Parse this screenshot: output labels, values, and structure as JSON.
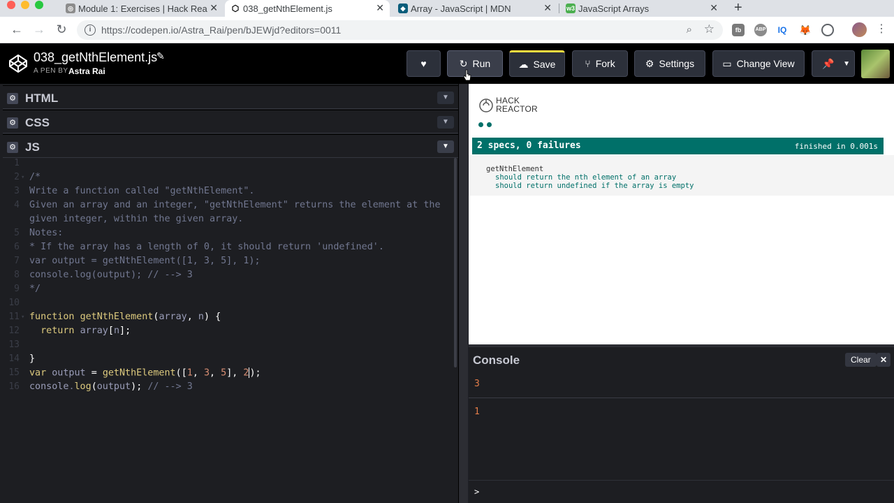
{
  "browser": {
    "tabs": [
      {
        "label": "Module 1: Exercises | Hack Rea",
        "icon": "codepen-icon",
        "active": false
      },
      {
        "label": "038_getNthElement.js",
        "icon": "codepen-icon",
        "active": true
      },
      {
        "label": "Array - JavaScript | MDN",
        "icon": "mdn-icon",
        "active": false
      },
      {
        "label": "JavaScript Arrays",
        "icon": "w3-icon",
        "active": false
      }
    ],
    "new_tab": "+",
    "url": "https://codepen.io/Astra_Rai/pen/bJEWjd?editors=0011",
    "extensions": [
      "fb",
      "ABP",
      "IQ"
    ]
  },
  "header": {
    "pen_title": "038_getNthElement.js",
    "pen_by": "A PEN BY",
    "author": "Astra Rai",
    "buttons": {
      "run": "Run",
      "save": "Save",
      "fork": "Fork",
      "settings": "Settings",
      "change_view": "Change View"
    }
  },
  "editor": {
    "panels": [
      "HTML",
      "CSS",
      "JS"
    ],
    "lines": [
      {
        "n": "1",
        "text": ""
      },
      {
        "n": "2",
        "text": "/*"
      },
      {
        "n": "3",
        "text": "Write a function called \"getNthElement\"."
      },
      {
        "n": "4",
        "text": "Given an array and an integer, \"getNthElement\" returns the element at the"
      },
      {
        "n": "",
        "text": "given integer, within the given array."
      },
      {
        "n": "5",
        "text": "Notes:"
      },
      {
        "n": "6",
        "text": "* If the array has a length of 0, it should return 'undefined'."
      },
      {
        "n": "7",
        "text": "var output = getNthElement([1, 3, 5], 1);"
      },
      {
        "n": "8",
        "text": "console.log(output); // --> 3"
      },
      {
        "n": "9",
        "text": "*/"
      },
      {
        "n": "10",
        "text": ""
      },
      {
        "n": "11",
        "text": "function getNthElement(array, n) {"
      },
      {
        "n": "12",
        "text": "  return array[n];"
      },
      {
        "n": "13",
        "text": ""
      },
      {
        "n": "14",
        "text": "}"
      },
      {
        "n": "15",
        "text": "var output = getNthElement([1, 3, 5], 2);"
      },
      {
        "n": "16",
        "text": "console.log(output); // --> 3"
      }
    ]
  },
  "result": {
    "brand_line1": "HACK",
    "brand_line2": "REACTOR",
    "summary": "2 specs, 0 failures",
    "finished": "finished in 0.001s",
    "suite": "getNthElement",
    "specs": [
      "should return the nth element of an array",
      "should return undefined if the array is empty"
    ],
    "colors": {
      "pass": "#007069"
    }
  },
  "console": {
    "title": "Console",
    "clear": "Clear",
    "close": "✕",
    "logs": [
      "3",
      "1"
    ],
    "prompt": ">"
  }
}
